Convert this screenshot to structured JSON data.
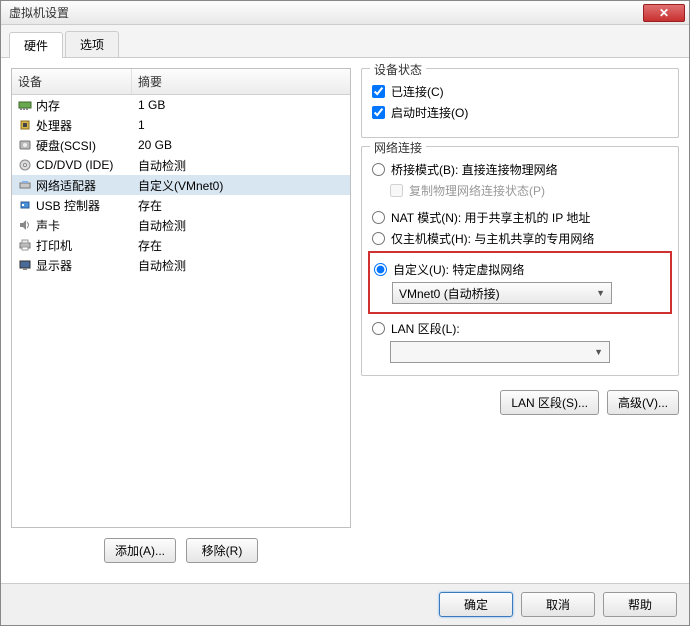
{
  "window": {
    "title": "虚拟机设置"
  },
  "tabs": {
    "hardware": "硬件",
    "options": "选项"
  },
  "columns": {
    "device": "设备",
    "summary": "摘要"
  },
  "devices": [
    {
      "name": "内存",
      "summary": "1 GB",
      "icon": "memory"
    },
    {
      "name": "处理器",
      "summary": "1",
      "icon": "cpu"
    },
    {
      "name": "硬盘(SCSI)",
      "summary": "20 GB",
      "icon": "disk"
    },
    {
      "name": "CD/DVD (IDE)",
      "summary": "自动检测",
      "icon": "cd"
    },
    {
      "name": "网络适配器",
      "summary": "自定义(VMnet0)",
      "icon": "net",
      "selected": true
    },
    {
      "name": "USB 控制器",
      "summary": "存在",
      "icon": "usb"
    },
    {
      "name": "声卡",
      "summary": "自动检测",
      "icon": "sound"
    },
    {
      "name": "打印机",
      "summary": "存在",
      "icon": "printer"
    },
    {
      "name": "显示器",
      "summary": "自动检测",
      "icon": "display"
    }
  ],
  "left_buttons": {
    "add": "添加(A)...",
    "remove": "移除(R)"
  },
  "status_group": {
    "title": "设备状态",
    "connected": "已连接(C)",
    "connect_at_poweron": "启动时连接(O)"
  },
  "net_group": {
    "title": "网络连接",
    "bridged": "桥接模式(B): 直接连接物理网络",
    "replicate": "复制物理网络连接状态(P)",
    "nat": "NAT 模式(N): 用于共享主机的 IP 地址",
    "hostonly": "仅主机模式(H): 与主机共享的专用网络",
    "custom": "自定义(U): 特定虚拟网络",
    "custom_value": "VMnet0 (自动桥接)",
    "lan": "LAN 区段(L):",
    "lan_value": ""
  },
  "right_buttons": {
    "lan_segments": "LAN 区段(S)...",
    "advanced": "高级(V)..."
  },
  "footer": {
    "ok": "确定",
    "cancel": "取消",
    "help": "帮助"
  }
}
